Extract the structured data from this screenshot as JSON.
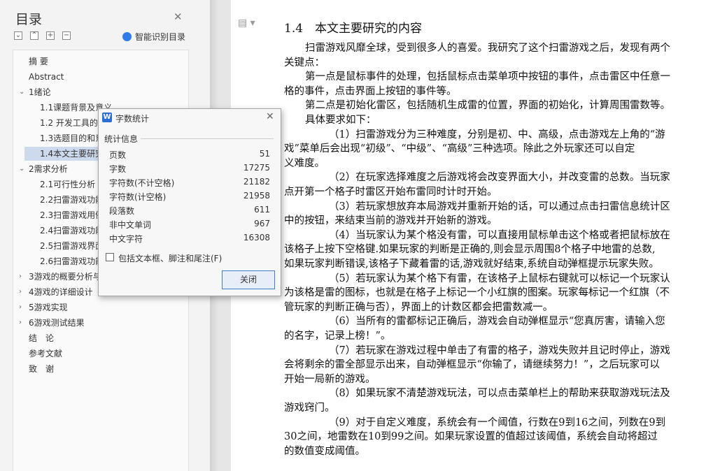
{
  "sidebar": {
    "title": "目录",
    "smart_label": "智能识别目录",
    "toc": [
      {
        "label": "摘 要"
      },
      {
        "label": "Abstract"
      },
      {
        "label": "1绪论"
      },
      {
        "label": "1.1课题背景及意义"
      },
      {
        "label": "1.2 开发工具的"
      },
      {
        "label": "1.3选题目的和意"
      },
      {
        "label": "1.4本文主要研究"
      },
      {
        "label": "2需求分析"
      },
      {
        "label": "2.1可行性分析"
      },
      {
        "label": "2.2扫雷游戏功能"
      },
      {
        "label": "2.3扫雷游戏用例"
      },
      {
        "label": "2.4扫雷游戏功能"
      },
      {
        "label": "2.5扫雷游戏界面"
      },
      {
        "label": "2.6扫雷游戏功能"
      },
      {
        "label": "3游戏的概要分析与"
      },
      {
        "label": "4游戏的详细设计"
      },
      {
        "label": "5游戏实现"
      },
      {
        "label": "6游戏测试结果"
      },
      {
        "label": "结　论"
      },
      {
        "label": "参考文献"
      },
      {
        "label": "致　谢"
      }
    ]
  },
  "document": {
    "heading": "1.4　本文主要研究的内容",
    "lines": [
      "扫雷游戏风靡全球，受到很多人的喜爱。我研究了这个扫雷游戏之后，发现有两个",
      "关键点：",
      "第一点是鼠标事件的处理，包括鼠标点击菜单项中按钮的事件，点击雷区中任意一",
      "格的事件，点击界面上按钮的事件等。",
      "第二点是初始化雷区，包括随机生成雷的位置，界面的初始化，计算周围雷数等。",
      "具体要求如下：",
      "（1）扫雷游戏分为三种难度，分别是初、中、高级，点击游戏左上角的“游",
      "戏”菜单后会出现“初级”、“中级”、“高级”三种选项。除此之外玩家还可以自定",
      "义难度。",
      "（2）在玩家选择难度之后游戏将会改变界面大小，并改变雷的总数。当玩家",
      "点开第一个格子时雷区开始布雷同时计时开始。",
      "（3）若玩家想放弃本局游戏并重新开始的话，可以通过点击扫雷信息统计区",
      "中的按钮，来结束当前的游戏并开始新的游戏。",
      "（4）当玩家认为某个格没有雷，可以直接用鼠标单击这个格或者把鼠标放在",
      "该格子上按下空格键.如果玩家的判断是正确的,则会显示周围8个格子中地雷的总数,",
      "如果玩家判断错误,该格子下藏着雷的话,游戏就好结束,系统自动弹框提示玩家失败。",
      "（5）若玩家认为某个格下有雷，在该格子上鼠标右键就可以标记一个玩家认",
      "为该格是雷的图标，也就是在格子上标记一个小红旗的图案。玩家每标记一个红旗（不",
      "管玩家的判断正确与否），界面上的计数区都会把雷数减一。",
      "（6）当所有的雷都标记正确后，游戏会自动弹框显示“您真厉害，请输入您",
      "的名字，记录上榜！”。",
      "（7）若玩家在游戏过程中单击了有雷的格子，游戏失败并且记时停止，游戏",
      "会将剩余的雷全部显示出来，自动弹框显示“你输了，请继续努力！”，之后玩家可以",
      "开始一局新的游戏。",
      "（8）如果玩家不清楚游戏玩法，可以点击菜单栏上的帮助来获取游戏玩法及",
      "游戏窍门。",
      "（9）对于自定义难度，系统会有一个阈值，行数在9到16之间，列数在9到",
      "30之间，地雷数在10到99之间。如果玩家设置的值超过该阈值，系统会自动将超过",
      "的数值变成阈值。"
    ]
  },
  "dialog": {
    "title": "字数统计",
    "group_label": "统计信息",
    "stats": [
      {
        "label": "页数",
        "value": "51"
      },
      {
        "label": "字数",
        "value": "17275"
      },
      {
        "label": "字符数(不计空格)",
        "value": "21182"
      },
      {
        "label": "字符数(计空格)",
        "value": "21958"
      },
      {
        "label": "段落数",
        "value": "611"
      },
      {
        "label": "非中文单词",
        "value": "967"
      },
      {
        "label": "中文字符",
        "value": "16308"
      }
    ],
    "checkbox_label": "包括文本框、脚注和尾注(F)",
    "close_label": "关闭"
  }
}
